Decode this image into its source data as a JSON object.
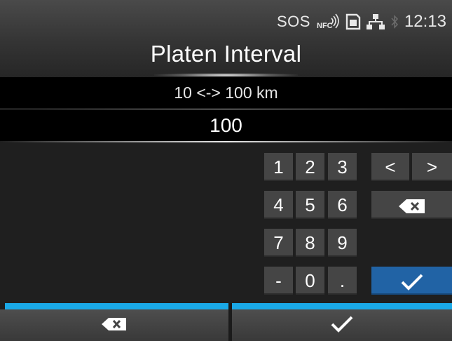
{
  "status_bar": {
    "sos_label": "SOS",
    "nfc_label": "NFC",
    "time": "12:13",
    "icons": [
      "nfc-icon",
      "sd-card-icon",
      "network-icon",
      "bluetooth-icon"
    ]
  },
  "header": {
    "title": "Platen Interval"
  },
  "input": {
    "range_label": "10 <-> 100 km",
    "current_value": "100"
  },
  "keypad": {
    "keys": {
      "k1": "1",
      "k2": "2",
      "k3": "3",
      "k4": "4",
      "k5": "5",
      "k6": "6",
      "k7": "7",
      "k8": "8",
      "k9": "9",
      "minus": "-",
      "k0": "0",
      "dot": ".",
      "left": "<",
      "right": ">"
    },
    "icons": [
      "backspace-icon",
      "check-icon"
    ]
  },
  "bottom_bar": {
    "icons": [
      "backspace-icon",
      "check-icon"
    ],
    "accent_color": "#1aa9e7"
  },
  "colors": {
    "enter_key": "#2163a5",
    "key_background": "#454545",
    "accent": "#1aa9e7"
  }
}
